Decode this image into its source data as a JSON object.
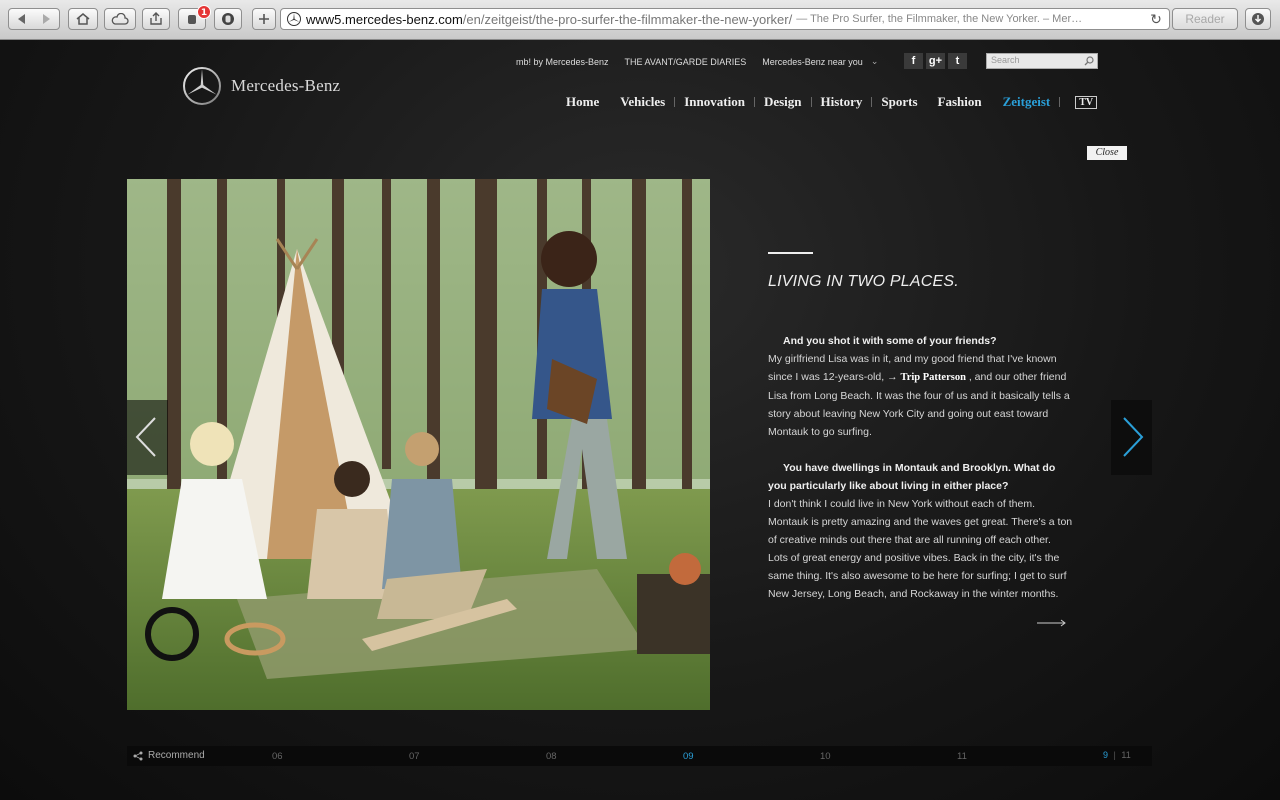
{
  "browser": {
    "badge_count": "1",
    "url_domain": "www5.mercedes-benz.com",
    "url_path": "/en/zeitgeist/the-pro-surfer-the-filmmaker-the-new-yorker/",
    "url_title": "— The Pro Surfer, the Filmmaker, the New Yorker. – Mer…",
    "reader_label": "Reader"
  },
  "brand": {
    "name": "Mercedes-Benz"
  },
  "top_links": [
    "mb! by Mercedes-Benz",
    "THE AVANT/GARDE DIARIES",
    "Mercedes-Benz near you"
  ],
  "social": {
    "facebook": "f",
    "google": "g+",
    "twitter": "t"
  },
  "search": {
    "placeholder": "Search"
  },
  "main_nav": [
    "Home",
    "Vehicles",
    "Innovation",
    "Design",
    "History",
    "Sports",
    "Fashion",
    "Zeitgeist"
  ],
  "main_nav_active": "Zeitgeist",
  "tv_label": "TV",
  "close_label": "Close",
  "article": {
    "title": "LIVING IN TWO PLACES.",
    "q1": "And you shot it with some of your friends?",
    "a1_part1": "My girlfriend Lisa was in it, and my good friend that I've known since I was 12-years-old,",
    "a1_link_arrow": "→",
    "a1_link": "Trip Patterson",
    "a1_part2": ", and our other friend Lisa from Long Beach. It was the four of us and it basically tells a story about leaving New York City and going out east toward Montauk to go surfing.",
    "q2": "You have dwellings in Montauk and Brooklyn. What do you particularly like about living in either place?",
    "a2": "I don't think I could live in New York without each of them. Montauk is pretty amazing and the waves get great. There's a ton of creative minds out there that are all running off each other. Lots of great energy and positive vibes. Back in the city, it's the same thing. It's also awesome to be here for surfing; I get to surf New Jersey, Long Beach, and Rockaway in the winter months."
  },
  "pager": {
    "recommend_label": "Recommend",
    "pages": [
      "06",
      "07",
      "08",
      "09",
      "10",
      "11"
    ],
    "active_page": "09",
    "current": "9",
    "separator": "|",
    "total": "11"
  },
  "colors": {
    "accent": "#2a9fd8",
    "background": "#141414"
  }
}
